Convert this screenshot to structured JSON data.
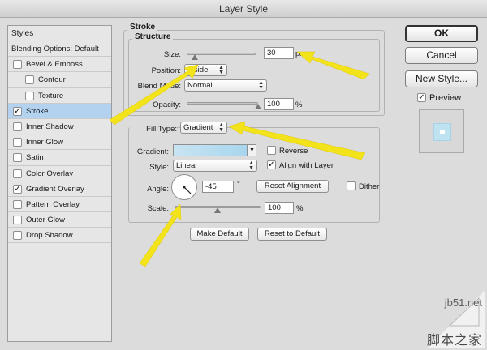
{
  "window": {
    "title": "Layer Style"
  },
  "styles_panel": {
    "header": "Styles",
    "items": [
      {
        "label": "Blending Options: Default",
        "checkbox": false,
        "checked": false,
        "indent": 0,
        "selected": false
      },
      {
        "label": "Bevel & Emboss",
        "checkbox": true,
        "checked": false,
        "indent": 0,
        "selected": false
      },
      {
        "label": "Contour",
        "checkbox": true,
        "checked": false,
        "indent": 1,
        "selected": false
      },
      {
        "label": "Texture",
        "checkbox": true,
        "checked": false,
        "indent": 1,
        "selected": false
      },
      {
        "label": "Stroke",
        "checkbox": true,
        "checked": true,
        "indent": 0,
        "selected": true
      },
      {
        "label": "Inner Shadow",
        "checkbox": true,
        "checked": false,
        "indent": 0,
        "selected": false
      },
      {
        "label": "Inner Glow",
        "checkbox": true,
        "checked": false,
        "indent": 0,
        "selected": false
      },
      {
        "label": "Satin",
        "checkbox": true,
        "checked": false,
        "indent": 0,
        "selected": false
      },
      {
        "label": "Color Overlay",
        "checkbox": true,
        "checked": false,
        "indent": 0,
        "selected": false
      },
      {
        "label": "Gradient Overlay",
        "checkbox": true,
        "checked": true,
        "indent": 0,
        "selected": false
      },
      {
        "label": "Pattern Overlay",
        "checkbox": true,
        "checked": false,
        "indent": 0,
        "selected": false
      },
      {
        "label": "Outer Glow",
        "checkbox": true,
        "checked": false,
        "indent": 0,
        "selected": false
      },
      {
        "label": "Drop Shadow",
        "checkbox": true,
        "checked": false,
        "indent": 0,
        "selected": false
      }
    ]
  },
  "stroke": {
    "section_title": "Stroke",
    "structure_title": "Structure",
    "size_label": "Size:",
    "size_value": "30",
    "size_unit": "px",
    "size_fraction": 0.12,
    "position_label": "Position:",
    "position_value": "Inside",
    "blend_mode_label": "Blend Mode:",
    "blend_mode_value": "Normal",
    "opacity_label": "Opacity:",
    "opacity_value": "100",
    "opacity_unit": "%",
    "opacity_fraction": 1.0
  },
  "fill": {
    "fill_type_label": "Fill Type:",
    "fill_type_value": "Gradient",
    "gradient_label": "Gradient:",
    "reverse_label": "Reverse",
    "reverse_checked": false,
    "style_label": "Style:",
    "style_value": "Linear",
    "align_label": "Align with Layer",
    "align_checked": true,
    "angle_label": "Angle:",
    "angle_value": "-45",
    "angle_unit": "°",
    "reset_alignment_label": "Reset Alignment",
    "dither_label": "Dither",
    "dither_checked": false,
    "scale_label": "Scale:",
    "scale_value": "100",
    "scale_unit": "%",
    "scale_fraction": 0.5,
    "gradient_colors": [
      "#c8e4f2",
      "#a8d6ee"
    ]
  },
  "buttons": {
    "make_default": "Make Default",
    "reset_to_default": "Reset to Default",
    "ok": "OK",
    "cancel": "Cancel",
    "new_style": "New Style...",
    "preview_label": "Preview",
    "preview_checked": true
  },
  "watermark": {
    "domain": "jb51.net",
    "chinese": "脚本之家"
  },
  "annotation_color": "#f2e31b"
}
